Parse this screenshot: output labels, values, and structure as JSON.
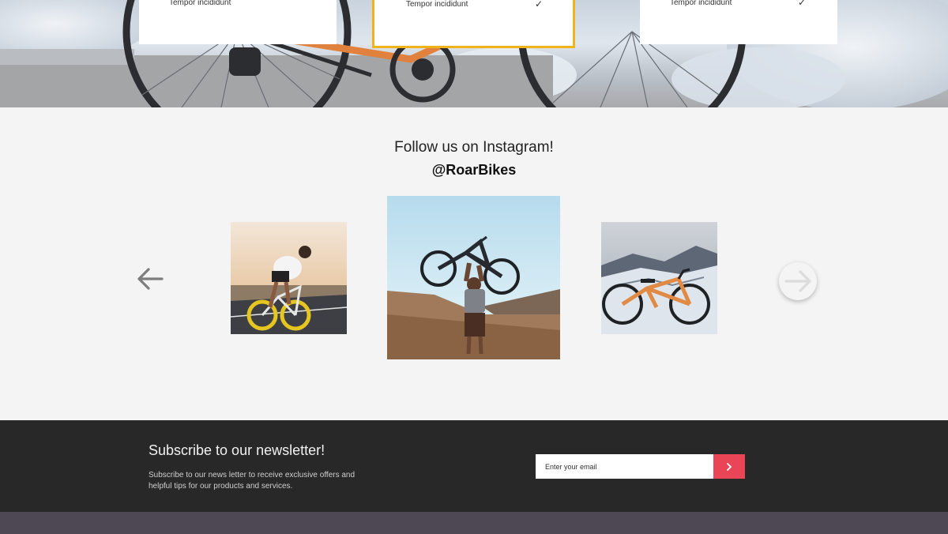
{
  "hero": {
    "plans": [
      {
        "label": "Tempor incididunt",
        "checked": false
      },
      {
        "label": "Tempor incididunt",
        "checked": true
      },
      {
        "label": "Tempor incididunt",
        "checked": true
      }
    ],
    "check_glyph": "✓"
  },
  "instagram": {
    "title": "Follow us on Instagram!",
    "handle": "@RoarBikes",
    "prev_icon": "arrow-left-icon",
    "next_icon": "arrow-right-icon",
    "photos": [
      {
        "name": "cyclist-yellow-bike"
      },
      {
        "name": "man-lifting-bike"
      },
      {
        "name": "orange-bike-in-snow"
      }
    ]
  },
  "newsletter": {
    "title": "Subscribe to our newsletter!",
    "description": "Subscribe to our news letter to receive exclusive offers and helpful tips for our products and services.",
    "input_placeholder": "Enter your email",
    "submit_icon": "chevron-right-icon",
    "accent_color": "#e94556"
  },
  "colors": {
    "selected_border": "#f0b31a",
    "newsletter_bg": "#282828",
    "footer_bg": "#4d4853"
  }
}
